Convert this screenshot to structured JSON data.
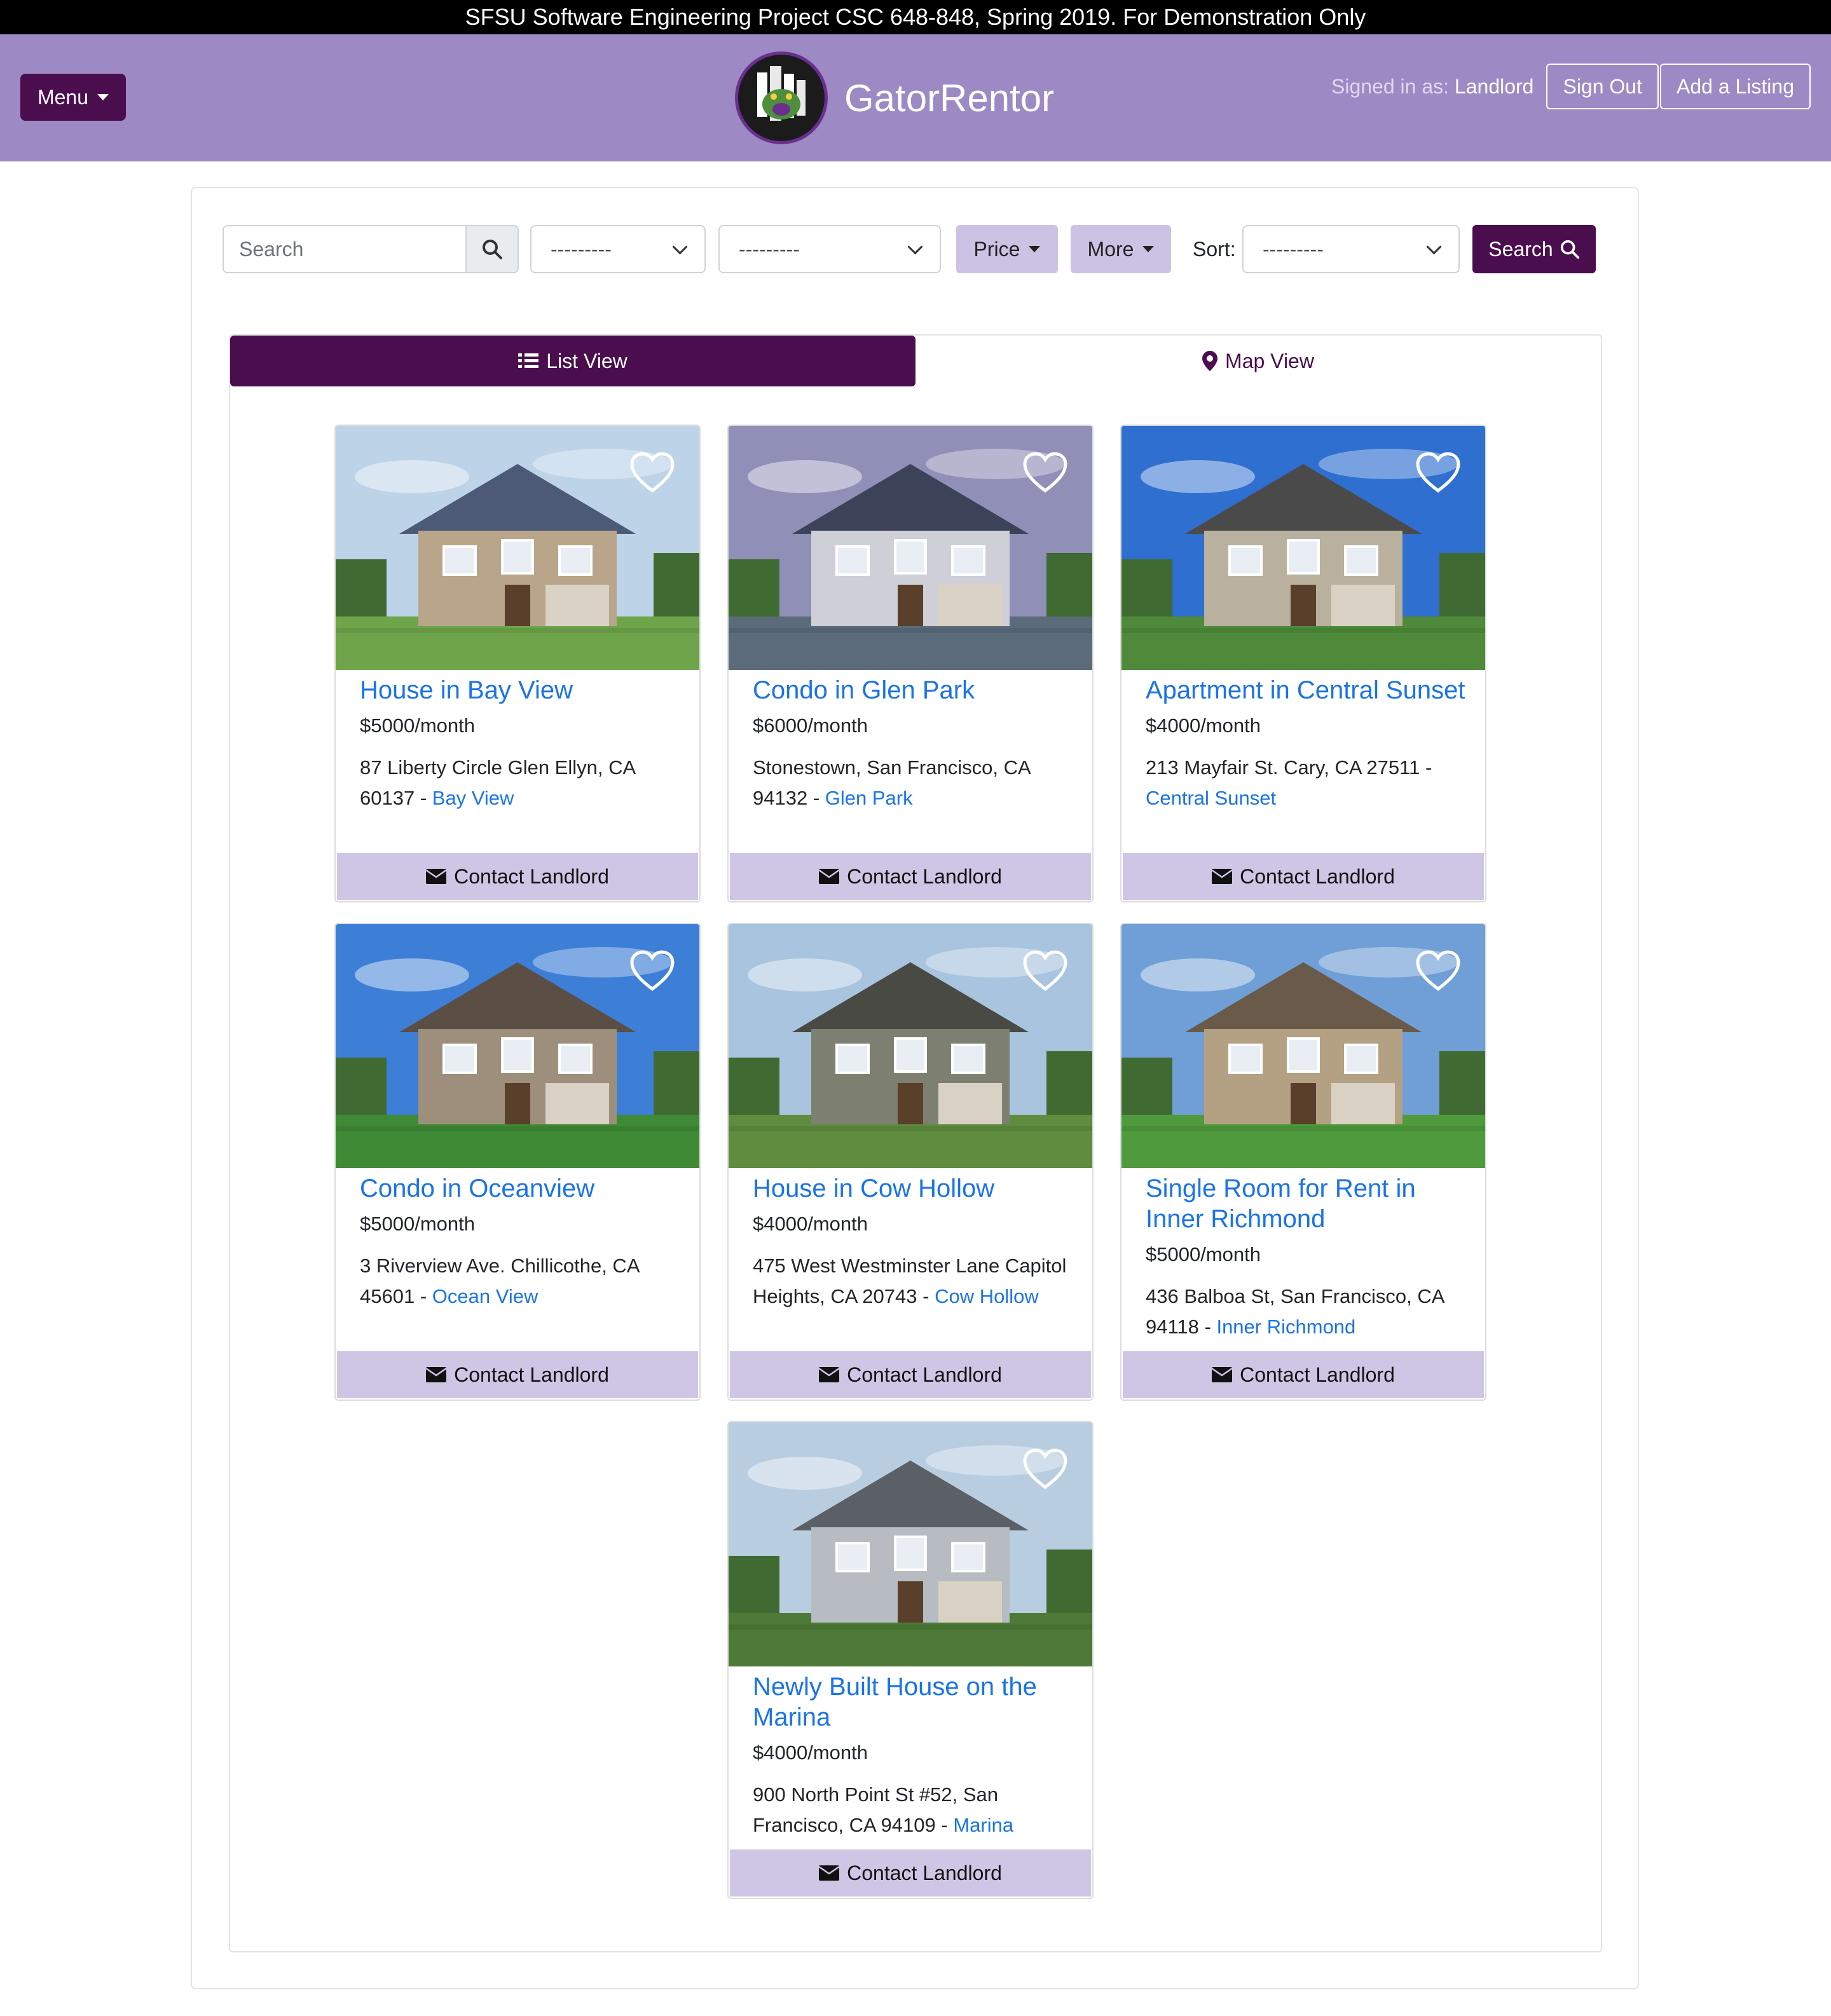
{
  "banner": "SFSU Software Engineering Project CSC 648-848, Spring 2019. For Demonstration Only",
  "nav": {
    "menu_label": "Menu",
    "brand": "GatorRentor",
    "signed_in_prefix": "Signed in as:",
    "signed_in_user": "Landlord",
    "sign_out": "Sign Out",
    "add_listing": "Add a Listing"
  },
  "filters": {
    "search_placeholder": "Search",
    "select1_value": "---------",
    "select2_value": "---------",
    "price_label": "Price",
    "more_label": "More",
    "sort_label": "Sort:",
    "sort_value": "---------",
    "search_button": "Search"
  },
  "tabs": {
    "list_view": "List View",
    "map_view": "Map View"
  },
  "contact_label": "Contact Landlord",
  "listings": [
    {
      "title": "House in Bay View",
      "price": "$5000/month",
      "address": "87 Liberty Circle Glen Ellyn, CA 60137 - ",
      "neighborhood": "Bay View",
      "sky": "#bcd3e8",
      "wall": "#b8a58a",
      "roof": "#4c5a78",
      "ground": "#6ea44a"
    },
    {
      "title": "Condo in Glen Park",
      "price": "$6000/month",
      "address": "Stonestown, San Francisco, CA 94132 - ",
      "neighborhood": "Glen Park",
      "sky": "#8f8fb8",
      "wall": "#cfcfd8",
      "roof": "#3c4258",
      "ground": "#5b6b7a"
    },
    {
      "title": "Apartment in Central Sunset",
      "price": "$4000/month",
      "address": "213 Mayfair St. Cary, CA 27511 - ",
      "neighborhood": "Central Sunset",
      "sky": "#2f6fcf",
      "wall": "#b9b09e",
      "roof": "#4a4a4a",
      "ground": "#4e8a3a"
    },
    {
      "title": "Condo in Oceanview",
      "price": "$5000/month",
      "address": "3 Riverview Ave. Chillicothe, CA 45601 - ",
      "neighborhood": "Ocean View",
      "sky": "#3d7fd6",
      "wall": "#9d8f7c",
      "roof": "#5a4e45",
      "ground": "#3f8a35"
    },
    {
      "title": "House in Cow Hollow",
      "price": "$4000/month",
      "address": "475 West Westminster Lane Capitol Heights, CA 20743 - ",
      "neighborhood": "Cow Hollow",
      "sky": "#a8c4de",
      "wall": "#7d8070",
      "roof": "#4a4a44",
      "ground": "#5f8c3e"
    },
    {
      "title": "Single Room for Rent in Inner Richmond",
      "price": "$5000/month",
      "address": "436 Balboa St, San Francisco, CA 94118 - ",
      "neighborhood": "Inner Richmond",
      "sky": "#6f9fd6",
      "wall": "#b4a183",
      "roof": "#6a5a4a",
      "ground": "#4f9a3c"
    },
    {
      "title": "Newly Built House on the Marina",
      "price": "$4000/month",
      "address": "900 North Point St #52, San Francisco, CA 94109 - ",
      "neighborhood": "Marina",
      "sky": "#b9cde0",
      "wall": "#b6bcc2",
      "roof": "#5b6066",
      "ground": "#4d7a36"
    }
  ]
}
